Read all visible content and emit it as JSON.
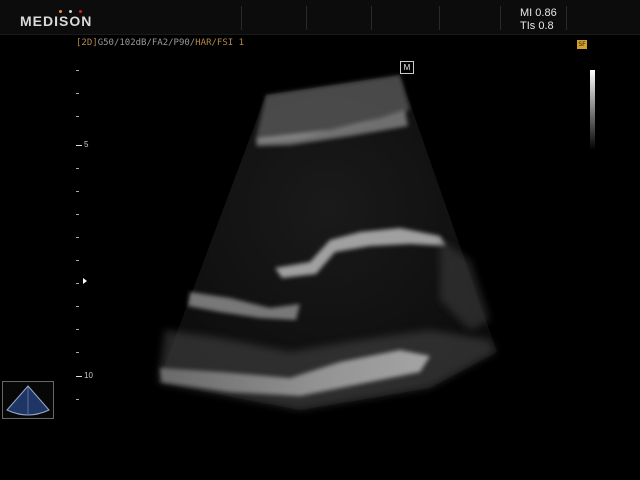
{
  "header": {
    "brand": "MEDISON",
    "mi_label": "MI 0.86",
    "tis_label": "TIs 0.8",
    "brand_dot_colors": [
      "#ff8c2a",
      "#d0d0d0",
      "#d42020"
    ]
  },
  "imaging_params": {
    "mode": "[2D]",
    "settings": "G50/102dB/FA2/P90/",
    "harmonic": "HAR/FSI 1"
  },
  "depth_scale": {
    "labels": [
      "5",
      "10"
    ]
  },
  "markers": {
    "m_marker": "M"
  },
  "colors": {
    "background": "#000000",
    "param_accent": "#b08a4a",
    "icon_accent": "#d1a02a"
  }
}
